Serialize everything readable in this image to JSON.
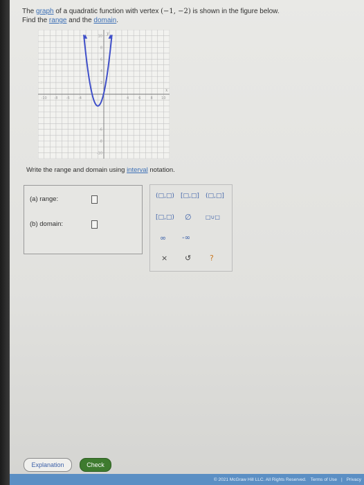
{
  "question": {
    "line1_pre": "The ",
    "line1_graph_link": "graph",
    "line1_mid": " of a quadratic function with vertex ",
    "vertex": "(−1, −2)",
    "line1_post": " is shown in the figure below.",
    "line2_pre": "Find the ",
    "range_link": "range",
    "line2_mid": " and the ",
    "domain_link": "domain",
    "line2_post": "."
  },
  "graph": {
    "x_axis_label": "x",
    "y_axis_label": "y",
    "x_ticks": [
      "-10",
      "-8",
      "-6",
      "-4",
      "4",
      "6",
      "8",
      "10"
    ],
    "y_ticks": [
      "10",
      "8",
      "6",
      "4",
      "2",
      "-6",
      "-8",
      "-10"
    ],
    "curve_color": "#3f4fc9",
    "vertex_x": -1,
    "vertex_y": -2
  },
  "instruction": {
    "pre": "Write the range and domain using ",
    "link": "interval",
    "post": " notation."
  },
  "answers": {
    "range_label": "(a)  range:",
    "domain_label": "(b)  domain:"
  },
  "keypad": {
    "open_open": "(□,□)",
    "closed_closed": "[□,□]",
    "open_closed": "(□,□]",
    "closed_open": "[□,□)",
    "empty_set": "∅",
    "union": "□∪□",
    "infinity": "∞",
    "neg_infinity": "-∞",
    "clear": "×",
    "undo": "↺",
    "help": "?"
  },
  "buttons": {
    "explanation": "Explanation",
    "check": "Check"
  },
  "footer": {
    "copyright": "© 2021 McGraw Hill LLC. All Rights Reserved.",
    "terms": "Terms of Use",
    "separator": "|",
    "privacy": "Privacy"
  }
}
